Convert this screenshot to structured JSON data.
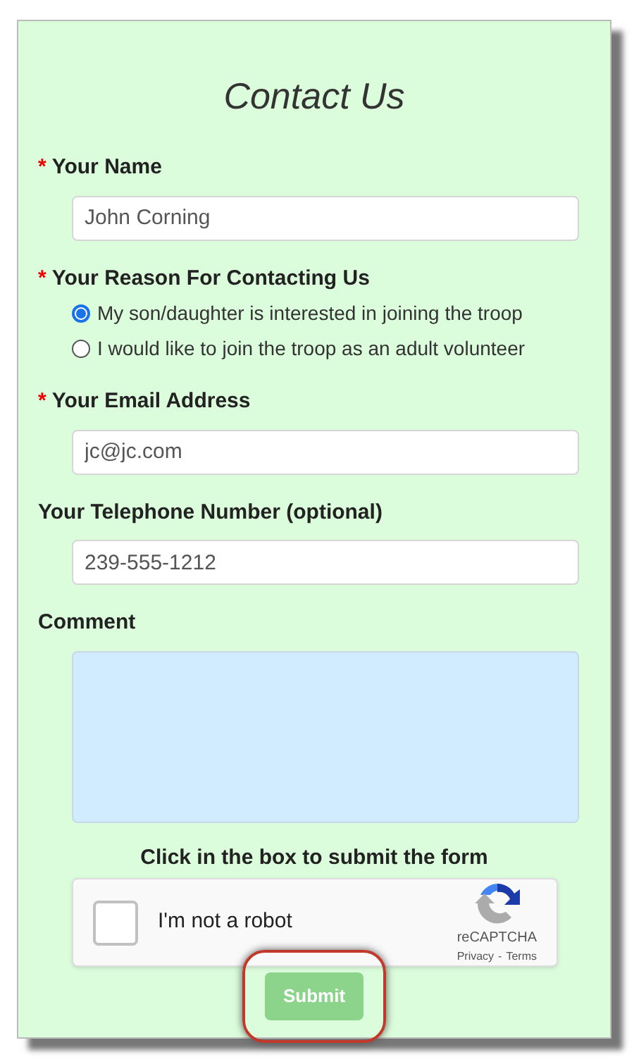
{
  "title": "Contact Us",
  "fields": [
    {
      "kind": "text",
      "label": "Your Name",
      "required_mark": "*",
      "value": "John Corning"
    },
    {
      "kind": "radio",
      "label": "Your Reason For Contacting Us",
      "required_mark": "*",
      "options": [
        {
          "label": "My son/daughter is interested in joining the troop",
          "selected": true
        },
        {
          "label": "I would like to join the troop as an adult volunteer",
          "selected": false
        }
      ]
    },
    {
      "kind": "text",
      "label": "Your Email Address",
      "required_mark": "*",
      "value": "jc@jc.com"
    },
    {
      "kind": "text",
      "label": "Your Telephone Number (optional)",
      "value": "239-555-1212"
    },
    {
      "kind": "textarea",
      "label": "Comment"
    }
  ],
  "captcha_prompt": "Click in the box to submit the form",
  "captcha": {
    "label": "I'm not a robot",
    "checked": false,
    "brand": "reCAPTCHA",
    "privacy": "Privacy",
    "separator": "-",
    "terms": "Terms"
  },
  "submit": {
    "label": "Submit",
    "disabled": true,
    "highlighted": true
  }
}
